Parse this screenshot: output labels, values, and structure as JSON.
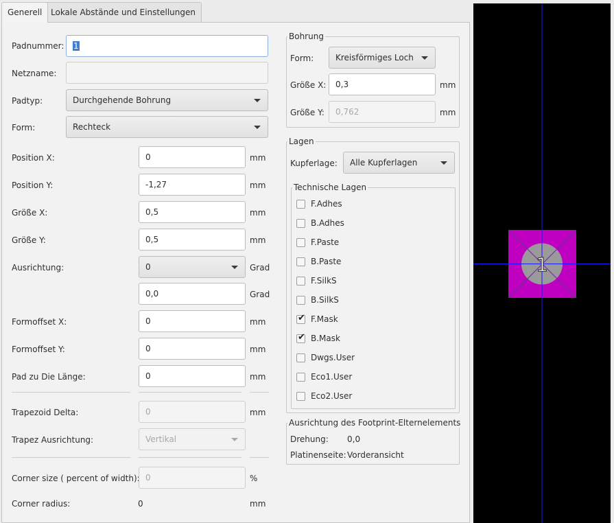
{
  "tabs": [
    "Generell",
    "Lokale Abstände und Einstellungen"
  ],
  "left": {
    "padnummer": {
      "label": "Padnummer:",
      "value": "1"
    },
    "netzname": {
      "label": "Netzname:",
      "value": ""
    },
    "padtyp": {
      "label": "Padtyp:",
      "value": "Durchgehende Bohrung"
    },
    "form": {
      "label": "Form:",
      "value": "Rechteck"
    },
    "pos_x": {
      "label": "Position X:",
      "value": "0",
      "unit": "mm"
    },
    "pos_y": {
      "label": "Position Y:",
      "value": "-1,27",
      "unit": "mm"
    },
    "size_x": {
      "label": "Größe X:",
      "value": "0,5",
      "unit": "mm"
    },
    "size_y": {
      "label": "Größe Y:",
      "value": "0,5",
      "unit": "mm"
    },
    "ausrichtung": {
      "label": "Ausrichtung:",
      "value": "0",
      "unit": "Grad",
      "value2": "0,0",
      "unit2": "Grad"
    },
    "formoffset_x": {
      "label": "Formoffset X:",
      "value": "0",
      "unit": "mm"
    },
    "formoffset_y": {
      "label": "Formoffset Y:",
      "value": "0",
      "unit": "mm"
    },
    "pad_die": {
      "label": "Pad zu Die Länge:",
      "value": "0",
      "unit": "mm"
    },
    "trapezoid_delta": {
      "label": "Trapezoid Delta:",
      "value": "0",
      "unit": "mm"
    },
    "trapez_ausrichtung": {
      "label": "Trapez Ausrichtung:",
      "value": "Vertikal"
    },
    "corner_size": {
      "label": "Corner size ( percent of width):",
      "value": "0",
      "unit": "%"
    },
    "corner_radius": {
      "label": "Corner radius:",
      "value": "0",
      "unit": "mm"
    }
  },
  "bohrung": {
    "title": "Bohrung",
    "form": {
      "label": "Form:",
      "value": "Kreisförmiges Loch"
    },
    "size_x": {
      "label": "Größe X:",
      "value": "0,3",
      "unit": "mm"
    },
    "size_y": {
      "label": "Größe Y:",
      "value": "0,762",
      "unit": "mm"
    }
  },
  "lagen": {
    "title": "Lagen",
    "kupfer": {
      "label": "Kupferlage:",
      "value": "Alle Kupferlagen"
    },
    "tech_title": "Technische Lagen",
    "layers": [
      {
        "name": "F.Adhes",
        "checked": false
      },
      {
        "name": "B.Adhes",
        "checked": false
      },
      {
        "name": "F.Paste",
        "checked": false
      },
      {
        "name": "B.Paste",
        "checked": false
      },
      {
        "name": "F.SilkS",
        "checked": false
      },
      {
        "name": "B.SilkS",
        "checked": false
      },
      {
        "name": "F.Mask",
        "checked": true
      },
      {
        "name": "B.Mask",
        "checked": true
      },
      {
        "name": "Dwgs.User",
        "checked": false
      },
      {
        "name": "Eco1.User",
        "checked": false
      },
      {
        "name": "Eco2.User",
        "checked": false
      }
    ]
  },
  "parent": {
    "title": "Ausrichtung des Footprint-Elternelements",
    "drehung": {
      "label": "Drehung:",
      "value": "0,0"
    },
    "seite": {
      "label": "Platinenseite:",
      "value": "Vorderansicht"
    }
  },
  "preview": {
    "pad_number": "1",
    "colors": {
      "background": "#000000",
      "pad": "#c000c0",
      "hole": "#9a9a9a",
      "axes": "#1a1aff"
    }
  },
  "icons": {
    "dropdown": "chevron-down-icon",
    "check": "checkmark-icon"
  }
}
